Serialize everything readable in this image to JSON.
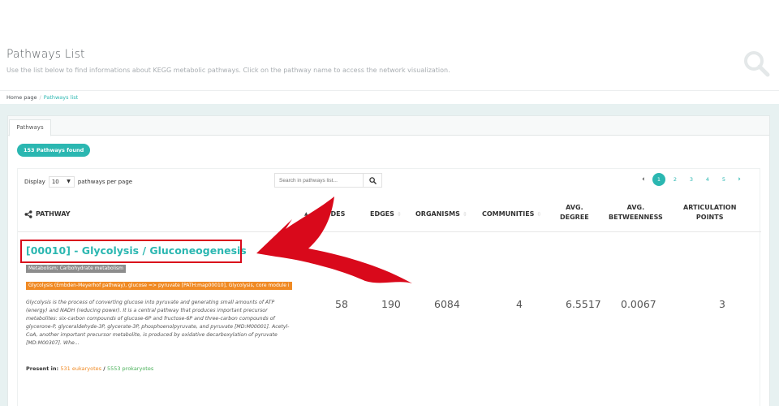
{
  "page": {
    "title": "Pathways List",
    "subtitle": "Use the list below to find informations about KEGG metabolic pathways. Click on the pathway name to access the network visualization."
  },
  "breadcrumb": {
    "home": "Home page",
    "current": "Pathways list"
  },
  "tabs": [
    {
      "label": "Pathways",
      "active": true
    }
  ],
  "found_badge": "153 Pathways found",
  "table_controls": {
    "display_label": "Display",
    "per_page_value": "10",
    "per_page_suffix": "pathways per page",
    "search_placeholder": "Search in pathways list...",
    "pagination": {
      "prev": "‹",
      "pages": [
        "1",
        "2",
        "3",
        "4",
        "5"
      ],
      "active_page": "1",
      "next": "›"
    }
  },
  "columns": {
    "pathway": "PATHWAY",
    "nodes": "NODES",
    "edges": "EDGES",
    "organisms": "ORGANISMS",
    "communities": "COMMUNITIES",
    "avg_degree_1": "AVG.",
    "avg_degree_2": "DEGREE",
    "avg_betweenness_1": "AVG.",
    "avg_betweenness_2": "BETWEENNESS",
    "articulation_1": "ARTICULATION",
    "articulation_2": "POINTS"
  },
  "rows": [
    {
      "name": "[00010] - Glycolysis / Gluconeogenesis",
      "category": "Metabolism; Carbohydrate metabolism",
      "module": "Glycolysis (Embden-Meyerhof pathway), glucose => pyruvate [PATH:map00010], Glycolysis, core module i",
      "description": "Glycolysis is the process of converting glucose into pyruvate and generating small amounts of ATP (energy) and NADH (reducing power). It is a central pathway that produces important precursor metabolites: six-carbon compounds of glucose-6P and fructose-6P and three-carbon compounds of glycerone-P, glyceraldehyde-3P, glycerate-3P, phosphoenolpyruvate, and pyruvate [MD:M00001]. Acetyl-CoA, another important precursor metabolite, is produced by oxidative decarboxylation of pyruvate [MD:M00307]. Whe...",
      "present_in_label": "Present in:",
      "eukaryotes": "531 eukaryotes",
      "separator": " / ",
      "prokaryotes": "5553 prokaryotes",
      "nodes": "58",
      "edges": "190",
      "organisms": "6084",
      "communities": "4",
      "avg_degree": "6.5517",
      "avg_betweenness": "0.0067",
      "articulation_points": "3"
    }
  ],
  "icons": {
    "header_search": "search-icon",
    "table_search": "search-icon",
    "pathway_column": "share-icon",
    "annotation": "red-arrow-annotation"
  },
  "colors": {
    "accent": "#2bb7b1",
    "highlight": "#d9091b",
    "category_badge": "#8d8d8d",
    "module_badge": "#f08a24",
    "prokaryotes": "#48b058"
  }
}
